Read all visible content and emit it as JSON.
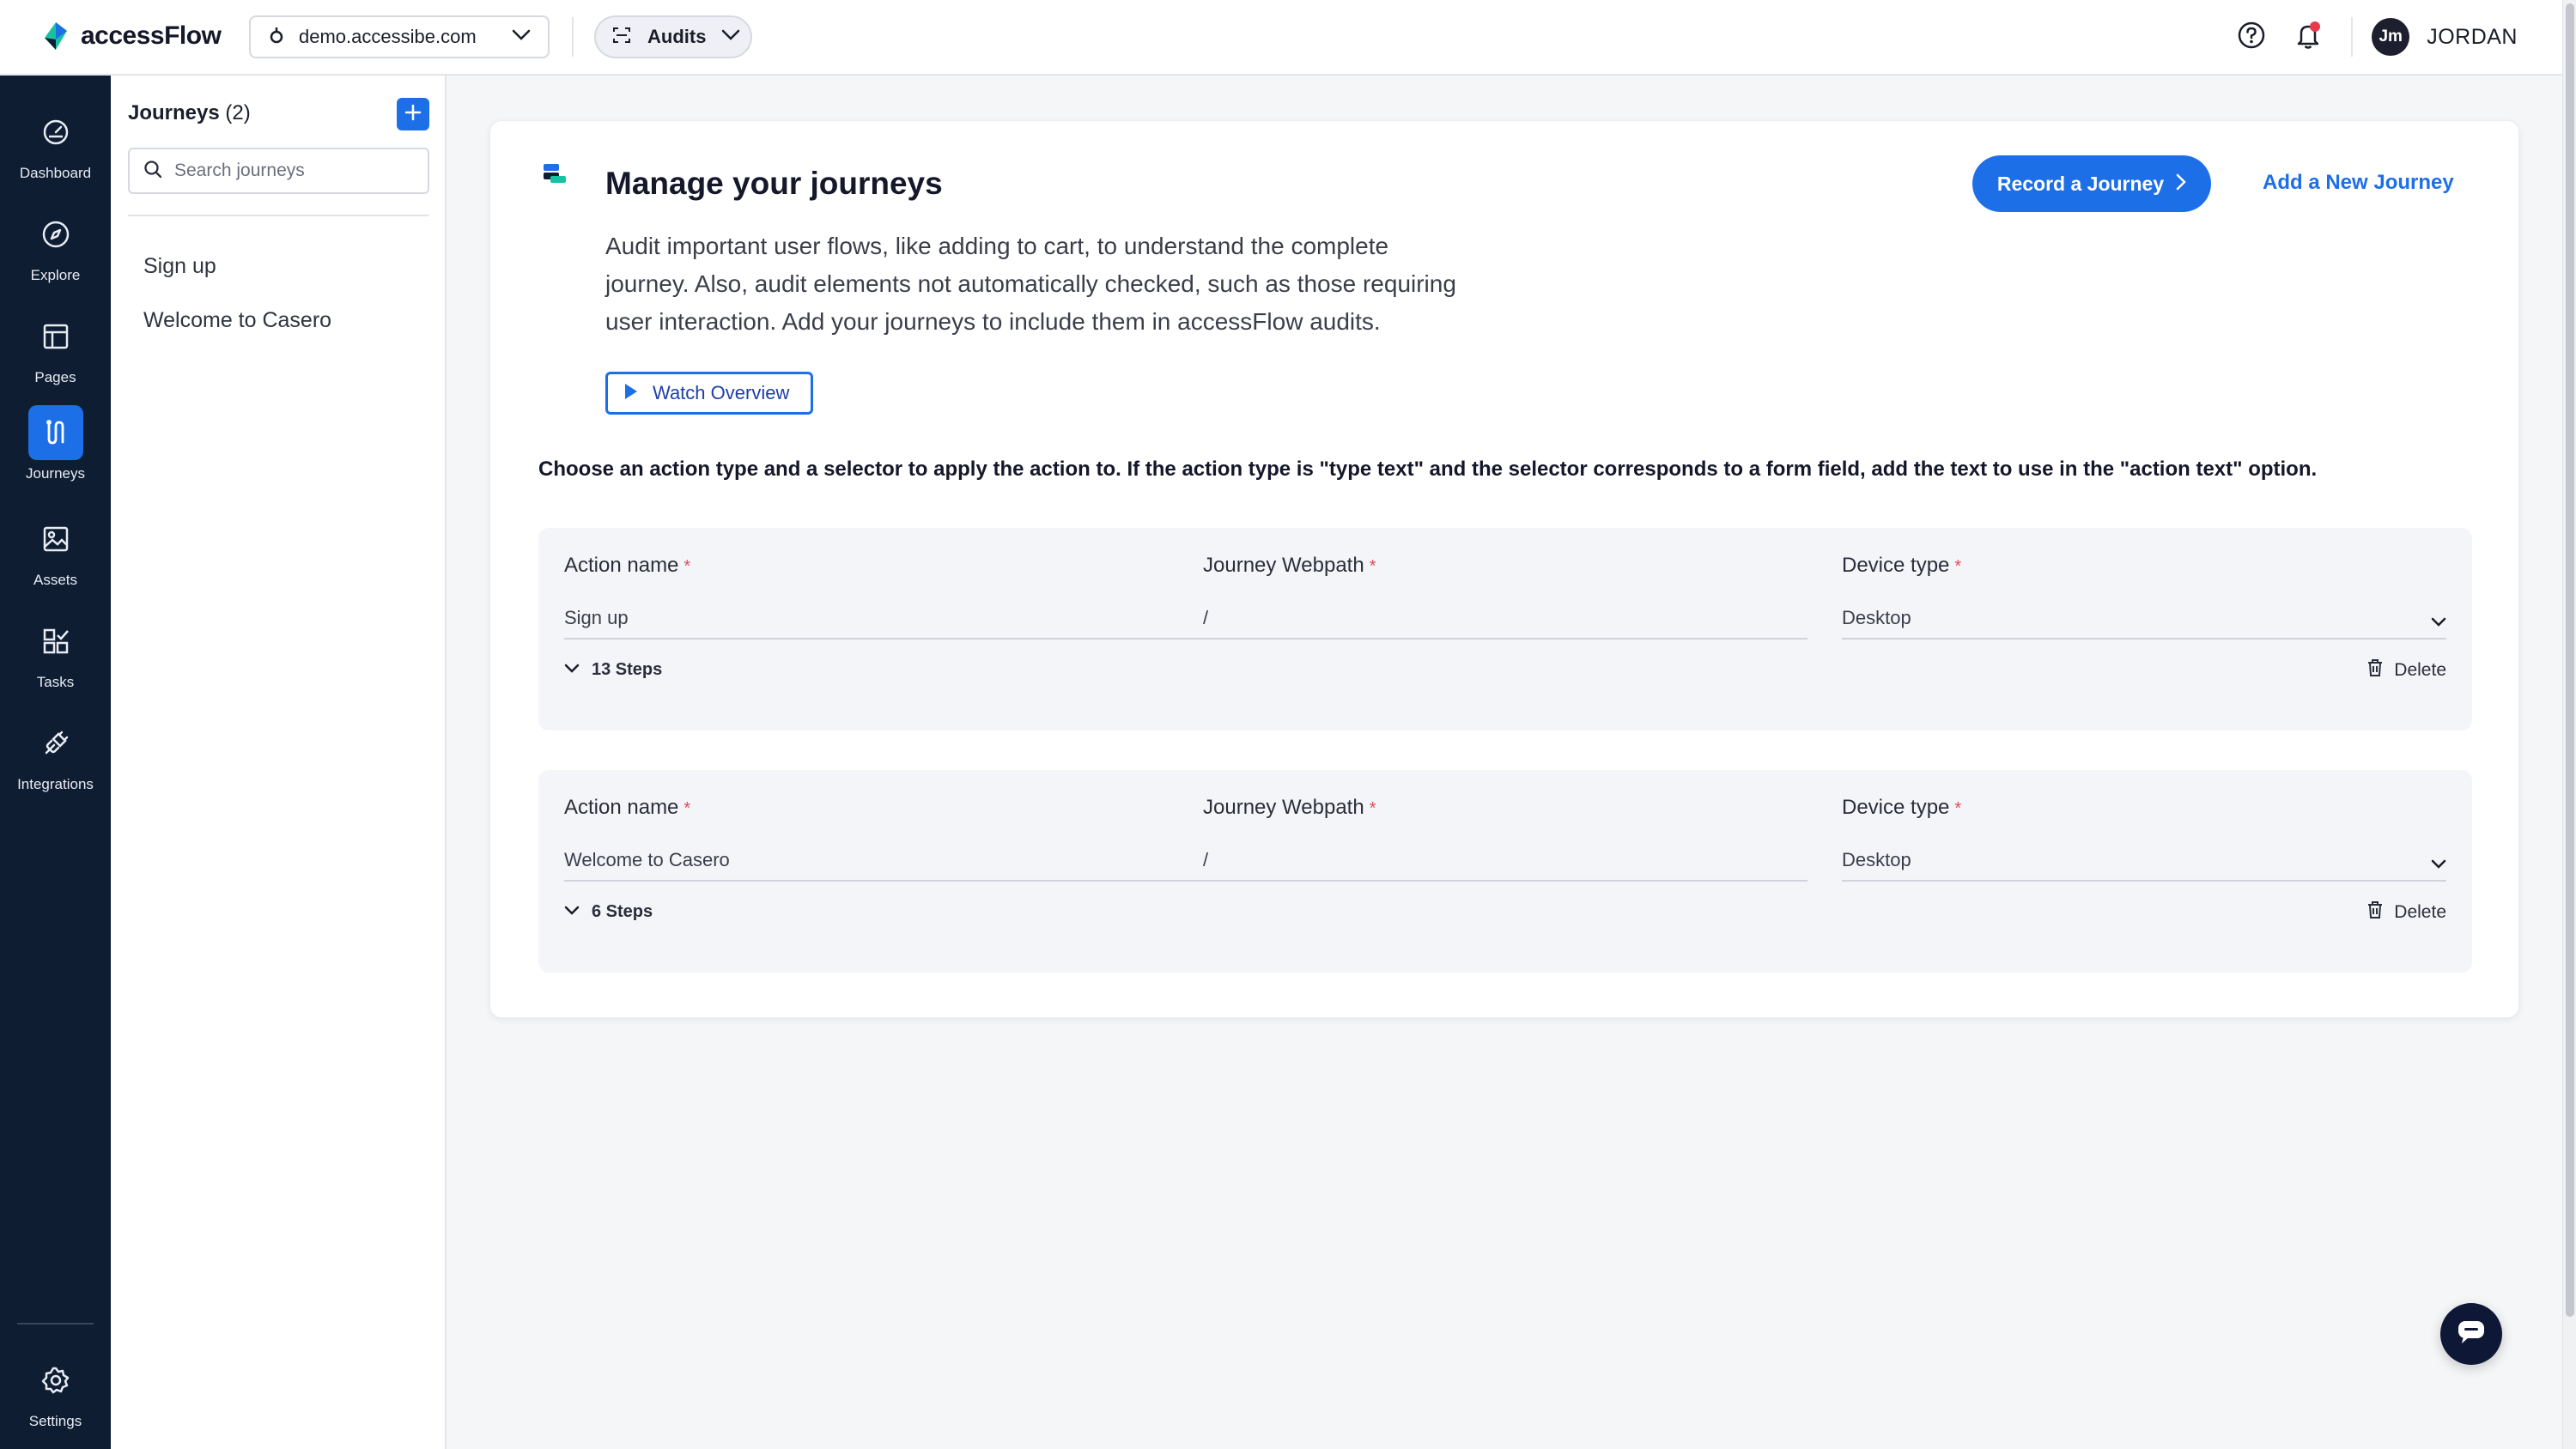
{
  "app": {
    "brand": "accessFlow"
  },
  "header": {
    "domain": "demo.accessibe.com",
    "section": "Audits",
    "user_initials": "Jm",
    "user_name": "JORDAN"
  },
  "nav": {
    "items": [
      {
        "label": "Dashboard",
        "icon": "gauge-icon"
      },
      {
        "label": "Explore",
        "icon": "compass-icon"
      },
      {
        "label": "Pages",
        "icon": "layout-icon"
      },
      {
        "label": "Journeys",
        "icon": "journey-icon",
        "active": true
      },
      {
        "label": "Assets",
        "icon": "image-icon"
      },
      {
        "label": "Tasks",
        "icon": "tasks-icon"
      },
      {
        "label": "Integrations",
        "icon": "plug-icon"
      }
    ],
    "settings": "Settings"
  },
  "sidepanel": {
    "title": "Journeys",
    "count": "(2)",
    "search_placeholder": "Search journeys",
    "items": [
      "Sign up",
      "Welcome to Casero"
    ]
  },
  "main": {
    "title": "Manage your journeys",
    "description": "Audit important user flows, like adding to cart, to understand the complete journey. Also, audit elements not automatically checked, such as those requiring user interaction. Add your journeys to include them in accessFlow audits.",
    "watch_label": "Watch Overview",
    "record_label": "Record a Journey",
    "add_label": "Add a New Journey",
    "instructions": "Choose an action type and a selector to apply the action to. If the action type is \"type text\" and the selector corresponds to a form field, add the text to use in the \"action text\" option.",
    "labels": {
      "action_name": "Action name",
      "webpath": "Journey Webpath",
      "device_type": "Device type",
      "required_mark": "*",
      "delete": "Delete"
    },
    "journeys": [
      {
        "action_name": "Sign up",
        "webpath": "/",
        "device_type": "Desktop",
        "steps": "13 Steps"
      },
      {
        "action_name": "Welcome to Casero",
        "webpath": "/",
        "device_type": "Desktop",
        "steps": "6 Steps"
      }
    ]
  },
  "colors": {
    "primary": "#1d6fe8",
    "nav_bg": "#0f1d32",
    "required": "#e5485d",
    "notification": "#e53b4f"
  }
}
